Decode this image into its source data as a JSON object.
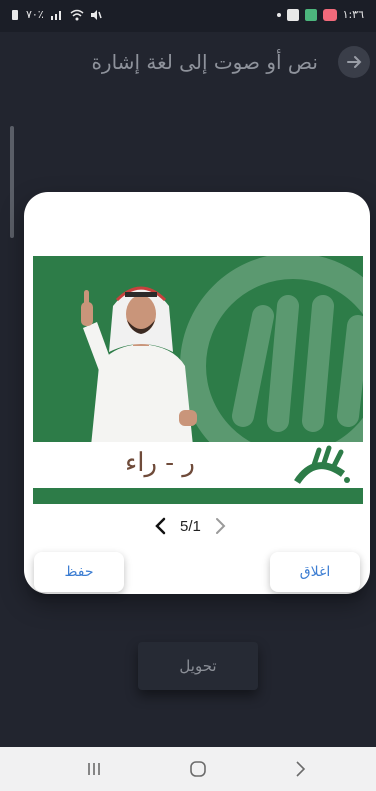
{
  "status_bar": {
    "time": "١:٣٦",
    "battery": "٧٠٪"
  },
  "header": {
    "title": "نص أو صوت إلى لغة إشارة",
    "back_icon": "arrow-right-icon"
  },
  "modal": {
    "caption": "ر - راء",
    "pager": {
      "current": "1",
      "total": "5",
      "display": "5/1"
    },
    "save_label": "حفظ",
    "close_label": "اغلاق"
  },
  "convert_label": "تحويل",
  "nav_bar": {
    "items": [
      "recents-icon",
      "home-icon",
      "back-icon"
    ]
  },
  "colors": {
    "background": "#22252f",
    "media_green": "#2d7c48",
    "button_text": "#3c7dd2"
  }
}
